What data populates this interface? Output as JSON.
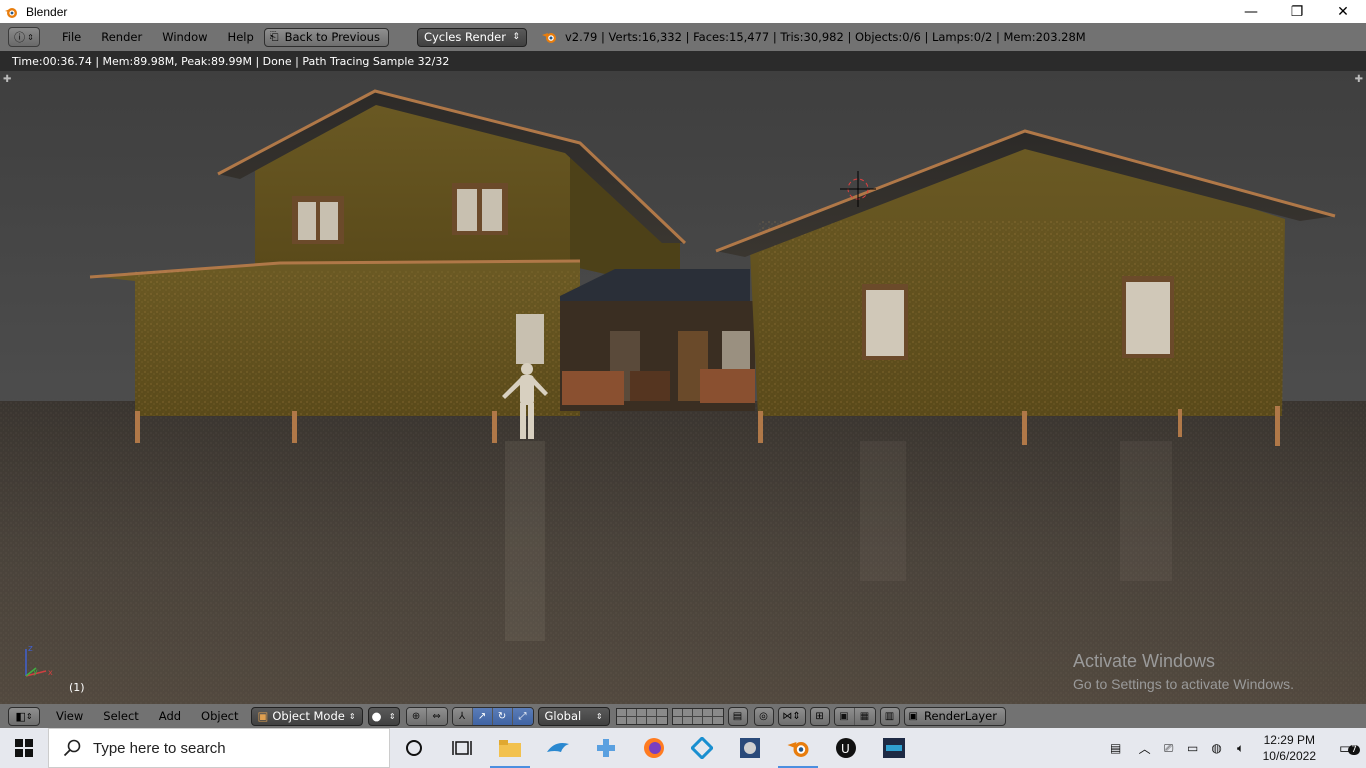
{
  "window": {
    "title": "Blender",
    "controls": {
      "minimize": "—",
      "restore": "❐",
      "close": "✕"
    }
  },
  "info_header": {
    "menu": [
      "File",
      "Render",
      "Window",
      "Help"
    ],
    "back_button": "Back to Previous",
    "render_engine": "Cycles Render",
    "stats": "v2.79 | Verts:16,332 | Faces:15,477 | Tris:30,982 | Objects:0/6 | Lamps:0/2 | Mem:203.28M"
  },
  "render_status": "Time:00:36.74 | Mem:89.98M, Peak:89.99M | Done | Path Tracing Sample 32/32",
  "viewport": {
    "frame": "(1)",
    "activate_title": "Activate Windows",
    "activate_sub": "Go to Settings to activate Windows."
  },
  "view_header": {
    "menu": [
      "View",
      "Select",
      "Add",
      "Object"
    ],
    "mode": "Object Mode",
    "orientation": "Global",
    "render_layer": "RenderLayer"
  },
  "taskbar": {
    "search_placeholder": "Type here to search",
    "time": "12:29 PM",
    "date": "10/6/2022",
    "notifications": "7"
  },
  "colors": {
    "blender_header": "#727272",
    "viewport_bg": "#444444",
    "accent_blue": "#4c8fe0",
    "blender_orange": "#e87d0d"
  }
}
